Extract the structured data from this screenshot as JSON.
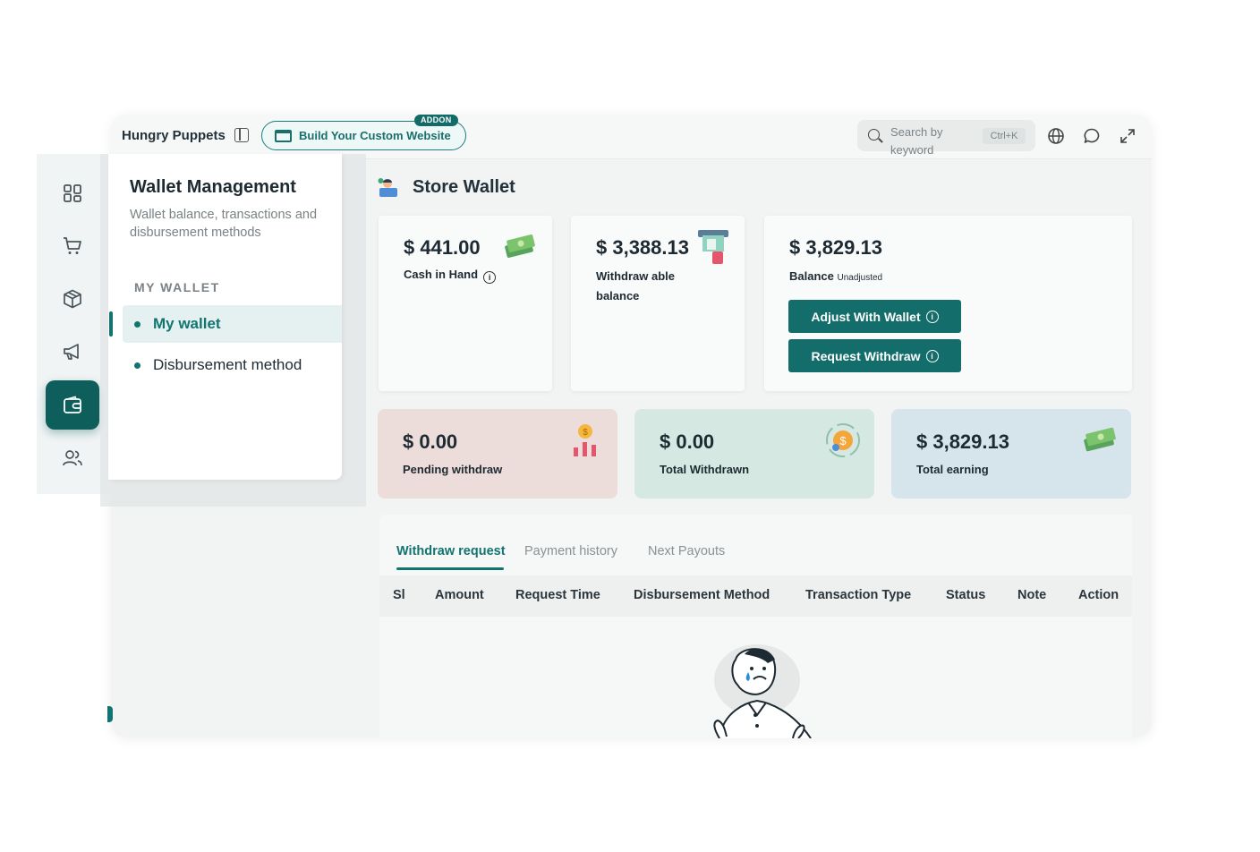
{
  "topbar": {
    "brand": "Hungry Puppets",
    "build_button": "Build Your Custom Website",
    "addon_badge": "ADDON",
    "search_placeholder": "Search by keyword",
    "search_shortcut": "Ctrl+K"
  },
  "rail": {
    "items": [
      "dashboard-icon",
      "cart-icon",
      "box-icon",
      "megaphone-icon",
      "wallet-icon",
      "users-icon"
    ],
    "active": "wallet-icon"
  },
  "submenu": {
    "title": "Wallet Management",
    "description": "Wallet balance, transactions and disbursement methods",
    "section": "MY WALLET",
    "items": [
      {
        "label": "My wallet",
        "active": true
      },
      {
        "label": "Disbursement method",
        "active": false
      }
    ]
  },
  "page": {
    "title": "Store Wallet"
  },
  "wallet": {
    "cash_in_hand": {
      "amount": "$ 441.00",
      "label": "Cash in Hand"
    },
    "withdrawable": {
      "amount": "$ 3,388.13",
      "label": "Withdraw able balance"
    },
    "balance": {
      "amount": "$ 3,829.13",
      "label": "Balance",
      "sublabel": "Unadjusted",
      "adjust_button": "Adjust With Wallet",
      "withdraw_button": "Request Withdraw"
    }
  },
  "stats": [
    {
      "amount": "$ 0.00",
      "label": "Pending withdraw",
      "bg": "#ecdcda"
    },
    {
      "amount": "$ 0.00",
      "label": "Total Withdrawn",
      "bg": "#d5e9e2"
    },
    {
      "amount": "$ 3,829.13",
      "label": "Total earning",
      "bg": "#d6e4ec"
    }
  ],
  "tabs": [
    "Withdraw request",
    "Payment history",
    "Next Payouts"
  ],
  "active_tab": "Withdraw request",
  "table": {
    "columns": [
      "Sl",
      "Amount",
      "Request Time",
      "Disbursement Method",
      "Transaction Type",
      "Status",
      "Note",
      "Action"
    ]
  },
  "colors": {
    "accent": "#127470",
    "accent_dark": "#0e5e5b"
  }
}
